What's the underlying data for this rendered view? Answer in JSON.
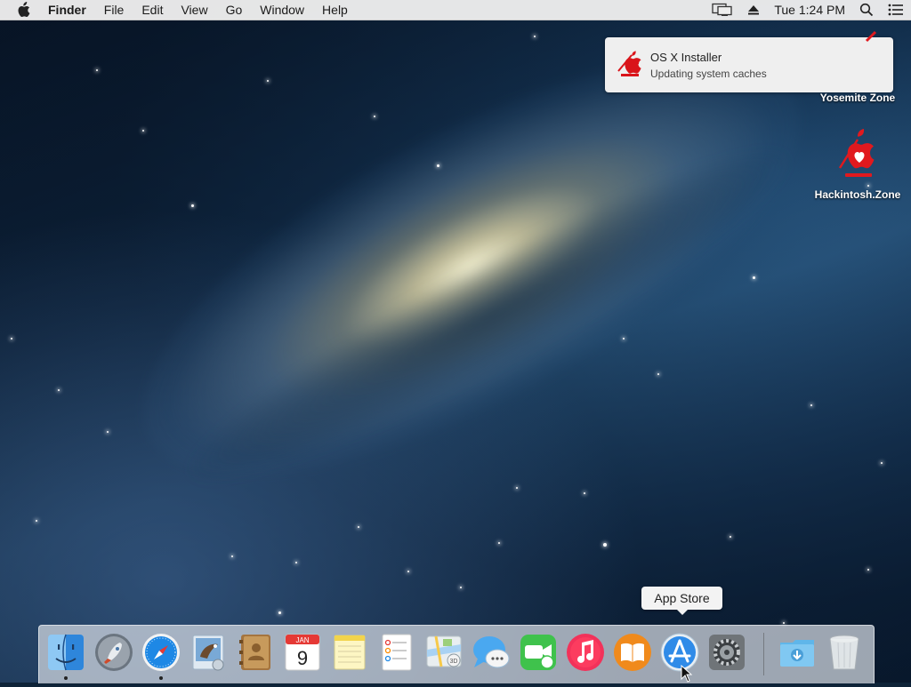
{
  "menubar": {
    "app_name": "Finder",
    "items": [
      "File",
      "Edit",
      "View",
      "Go",
      "Window",
      "Help"
    ],
    "clock": "Tue 1:24 PM",
    "status_icons": [
      "display-mirroring-icon",
      "eject-icon",
      "spotlight-icon",
      "notification-center-icon"
    ]
  },
  "notification": {
    "title": "OS X Installer",
    "body": "Updating system caches",
    "icon": "hackintosh-zone-logo"
  },
  "desktop_icons": [
    {
      "label": "Yosemite Zone",
      "icon": "hackintosh-zone-logo"
    },
    {
      "label": "Hackintosh.Zone",
      "icon": "hackintosh-zone-heart-logo"
    }
  ],
  "dock": {
    "tooltip": "App Store",
    "calendar": {
      "month": "JAN",
      "day": "9"
    },
    "items": [
      {
        "name": "Finder",
        "icon": "finder-icon",
        "running": true
      },
      {
        "name": "Launchpad",
        "icon": "launchpad-icon",
        "running": false
      },
      {
        "name": "Safari",
        "icon": "safari-icon",
        "running": true
      },
      {
        "name": "Mail",
        "icon": "mail-icon",
        "running": false
      },
      {
        "name": "Contacts",
        "icon": "contacts-icon",
        "running": false
      },
      {
        "name": "Calendar",
        "icon": "calendar-icon",
        "running": false
      },
      {
        "name": "Notes",
        "icon": "notes-icon",
        "running": false
      },
      {
        "name": "Reminders",
        "icon": "reminders-icon",
        "running": false
      },
      {
        "name": "Maps",
        "icon": "maps-icon",
        "running": false
      },
      {
        "name": "Messages",
        "icon": "messages-icon",
        "running": false
      },
      {
        "name": "FaceTime",
        "icon": "facetime-icon",
        "running": false
      },
      {
        "name": "iTunes",
        "icon": "itunes-icon",
        "running": false
      },
      {
        "name": "iBooks",
        "icon": "ibooks-icon",
        "running": false
      },
      {
        "name": "App Store",
        "icon": "app-store-icon",
        "running": false
      },
      {
        "name": "System Preferences",
        "icon": "system-preferences-icon",
        "running": false
      },
      {
        "name": "Downloads",
        "icon": "downloads-folder-icon",
        "running": false
      },
      {
        "name": "Trash",
        "icon": "trash-icon",
        "running": false
      }
    ]
  }
}
